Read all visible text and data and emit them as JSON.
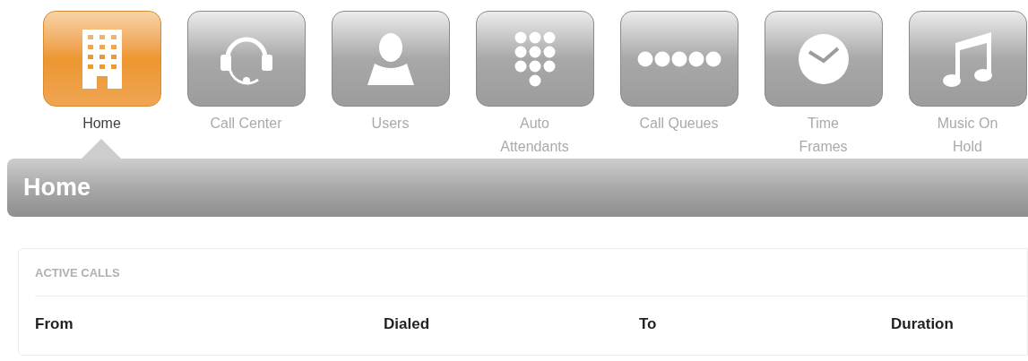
{
  "tabs": [
    {
      "kind": "building",
      "label_lines": [
        "Home"
      ],
      "selected": true
    },
    {
      "kind": "headset",
      "label_lines": [
        "Call Center"
      ],
      "selected": false
    },
    {
      "kind": "person",
      "label_lines": [
        "Users"
      ],
      "selected": false
    },
    {
      "kind": "keypad",
      "label_lines": [
        "Auto",
        "Attendants"
      ],
      "selected": false
    },
    {
      "kind": "dots",
      "label_lines": [
        "Call Queues"
      ],
      "selected": false
    },
    {
      "kind": "clock",
      "label_lines": [
        "Time",
        "Frames"
      ],
      "selected": false
    },
    {
      "kind": "music",
      "label_lines": [
        "Music On",
        "Hold"
      ],
      "selected": false
    }
  ],
  "page_title": "Home",
  "active_calls": {
    "title": "ACTIVE CALLS",
    "columns": [
      "From",
      "Dialed",
      "To",
      "Duration"
    ]
  }
}
